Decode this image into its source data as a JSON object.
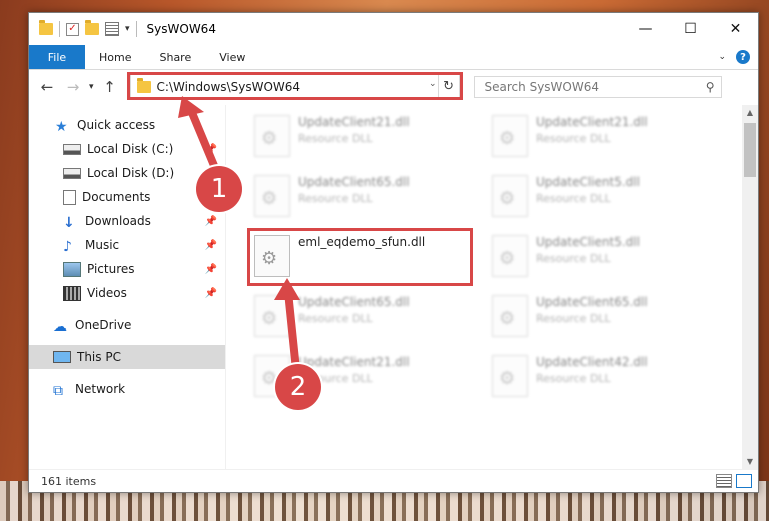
{
  "window": {
    "title": "SysWOW64"
  },
  "ribbon": {
    "tabs": [
      "File",
      "Home",
      "Share",
      "View"
    ],
    "help": "?"
  },
  "nav": {
    "address": "C:\\Windows\\SysWOW64",
    "search_placeholder": "Search SysWOW64"
  },
  "sidebar": {
    "items": [
      {
        "label": "Quick access",
        "icon": "star-icon",
        "pinned": false
      },
      {
        "label": "Local Disk (C:)",
        "icon": "drive-icon",
        "pinned": true
      },
      {
        "label": "Local Disk (D:)",
        "icon": "drive-icon",
        "pinned": false
      },
      {
        "label": "Documents",
        "icon": "document-icon",
        "pinned": true
      },
      {
        "label": "Downloads",
        "icon": "download-icon",
        "pinned": true
      },
      {
        "label": "Music",
        "icon": "music-icon",
        "pinned": true
      },
      {
        "label": "Pictures",
        "icon": "picture-icon",
        "pinned": true
      },
      {
        "label": "Videos",
        "icon": "video-icon",
        "pinned": true
      },
      {
        "label": "OneDrive",
        "icon": "cloud-icon",
        "pinned": false
      },
      {
        "label": "This PC",
        "icon": "computer-icon",
        "pinned": false,
        "selected": true
      },
      {
        "label": "Network",
        "icon": "network-icon",
        "pinned": false
      }
    ]
  },
  "files": [
    {
      "name": "UpdateClient21.dll",
      "type": "Resource DLL",
      "blurred": true
    },
    {
      "name": "UpdateClient21.dll",
      "type": "Resource DLL",
      "blurred": true
    },
    {
      "name": "UpdateClient65.dll",
      "type": "Resource DLL",
      "blurred": true
    },
    {
      "name": "UpdateClient5.dll",
      "type": "Resource DLL",
      "blurred": true
    },
    {
      "name": "eml_eqdemo_sfun.dll",
      "type": "",
      "blurred": false,
      "highlighted": true
    },
    {
      "name": "UpdateClient5.dll",
      "type": "Resource DLL",
      "blurred": true
    },
    {
      "name": "UpdateClient65.dll",
      "type": "Resource DLL",
      "blurred": true
    },
    {
      "name": "UpdateClient65.dll",
      "type": "Resource DLL",
      "blurred": true
    },
    {
      "name": "UpdateClient21.dll",
      "type": "Resource DLL",
      "blurred": true
    },
    {
      "name": "UpdateClient42.dll",
      "type": "Resource DLL",
      "blurred": true
    }
  ],
  "status": {
    "item_count": "161 items"
  },
  "callouts": [
    "1",
    "2"
  ],
  "colors": {
    "accent": "#1979ca",
    "annotation": "#d84747",
    "selected_nav": "#d9d9d9"
  }
}
